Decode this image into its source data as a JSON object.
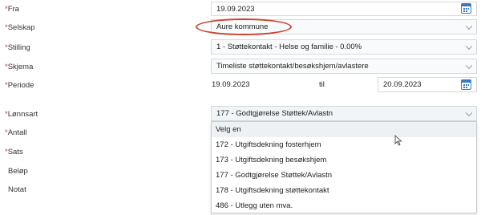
{
  "form": {
    "fra": {
      "label": "Fra",
      "value": "19.09.2023",
      "icon": "calendar-icon"
    },
    "selskap": {
      "label": "Selskap",
      "value": "Aure kommune"
    },
    "stilling": {
      "label": "Stilling",
      "value": "1 - Støttekontakt - Helse og familie - 0.00%"
    },
    "skjema": {
      "label": "Skjema",
      "value": "Timeliste støttekontakt/besøkshjem/avlastere"
    },
    "periode": {
      "label": "Periode",
      "from": "19.09.2023",
      "til_label": "til",
      "to": "20.09.2023",
      "icon": "calendar-icon"
    },
    "lonnsart": {
      "label": "Lønnsart",
      "value": "177 - Godtgjørelse Støttek/Avlastn"
    },
    "antall": {
      "label": "Antall"
    },
    "sats": {
      "label": "Sats"
    },
    "belop": {
      "label": "Beløp"
    },
    "notat": {
      "label": "Notat"
    }
  },
  "required_marker": "*",
  "dropdown": {
    "options": [
      "Velg en",
      "172 - Utgiftsdekning fosterhjem",
      "173 - Utgiftsdekning besøkshjem",
      "177 - Godtgjørelse Støttek/Avlastn",
      "178 - Utgiftsdekning støttekontakt",
      "486 - Utlegg uten mva."
    ]
  },
  "colors": {
    "required": "#d23a2a",
    "highlight": "#c8442e",
    "calendar_icon": "#3a78c2"
  }
}
